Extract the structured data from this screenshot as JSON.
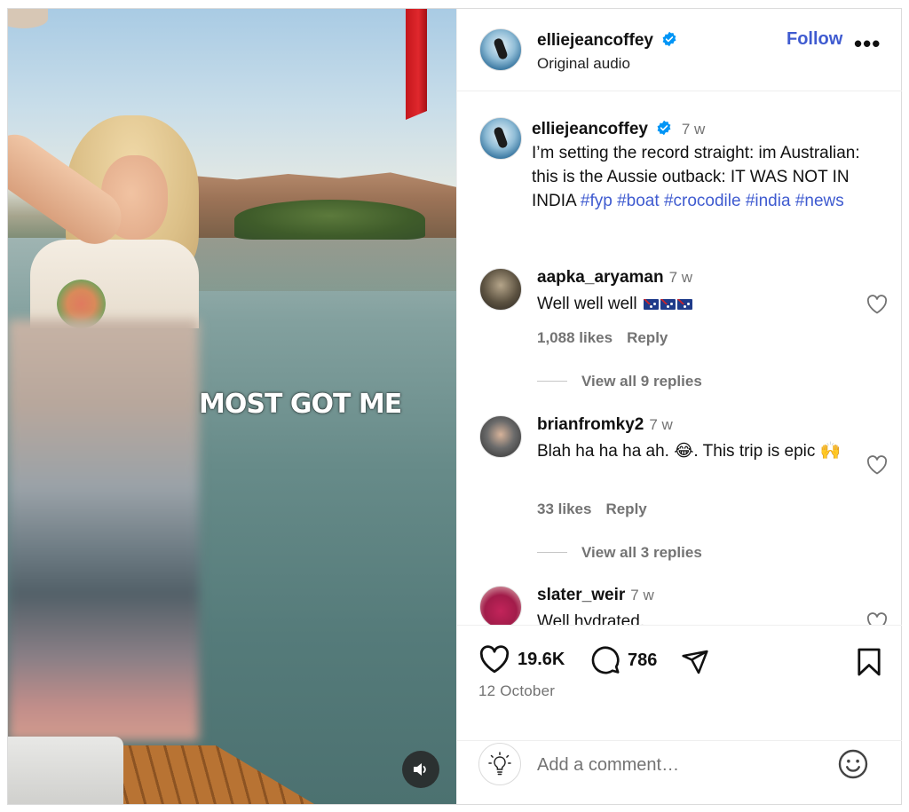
{
  "post": {
    "author": "elliejeancoffey",
    "audio": "Original audio",
    "follow_label": "Follow",
    "more_label": "•••",
    "overlay_text": "MOST GOT ME",
    "caption": {
      "time": "7 w",
      "text": "I’m setting the record straight: im Australian: this is the Aussie outback: IT WAS NOT IN INDIA",
      "hashtags": [
        "#fyp",
        "#boat",
        "#crocodile",
        "#india",
        "#news"
      ]
    }
  },
  "comments": [
    {
      "user": "aapka_aryaman",
      "time": "7 w",
      "text": "Well well well",
      "emoji": [
        "flag-australia",
        "flag-australia",
        "flag-australia"
      ],
      "likes": "1,088 likes",
      "reply_label": "Reply",
      "replies_label": "View all 9 replies"
    },
    {
      "user": "brianfromky2",
      "time": "7 w",
      "text": "Blah ha ha ha ah. 😂. This trip is epic 🙌",
      "likes": "33 likes",
      "reply_label": "Reply",
      "replies_label": "View all 3 replies"
    },
    {
      "user": "slater_weir",
      "time": "7 w",
      "text": "Well hydrated."
    }
  ],
  "actions": {
    "likes_count": "19.6K",
    "comments_count": "786",
    "date": "12 October"
  },
  "add_comment": {
    "placeholder": "Add a comment…"
  },
  "colors": {
    "link": "#3f5bd0",
    "muted": "#737373",
    "verified": "#0095f6"
  }
}
